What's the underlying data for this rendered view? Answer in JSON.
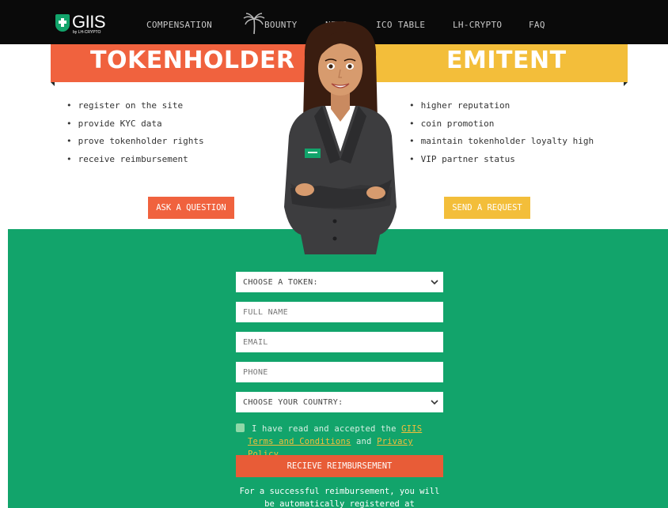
{
  "nav": {
    "logo_main": "GIIS",
    "logo_sub": "by LH-CRYPTO",
    "items": [
      "COMPENSATION",
      "BOUNTY",
      "NEWS",
      "ICO TABLE",
      "LH-CRYPTO",
      "FAQ"
    ]
  },
  "left": {
    "title": "TOKENHOLDER",
    "items": [
      "register on the site",
      "provide KYC data",
      "prove tokenholder rights",
      "receive reimbursement"
    ],
    "button": "ASK A QUESTION"
  },
  "right": {
    "title": "EMITENT",
    "items": [
      "higher reputation",
      "coin promotion",
      "maintain tokenholder loyalty high",
      "VIP partner status"
    ],
    "button": "SEND A REQUEST"
  },
  "form": {
    "token_select": "CHOOSE A TOKEN:",
    "full_name_placeholder": "FULL NAME",
    "email_placeholder": "EMAIL",
    "phone_placeholder": "PHONE",
    "country_select": "CHOOSE YOUR COUNTRY:",
    "agree_prefix": "I have read and accepted the",
    "agree_brand": "GIIS",
    "terms_link": "Terms and Conditions",
    "agree_and": "and",
    "privacy_link": "Privacy Policy",
    "submit": "RECIEVE REIMBURSEMENT",
    "note": "For a successful reimbursement, you will be automatically registered at"
  },
  "colors": {
    "nav_bg": "#0a0a0a",
    "orange": "#f0623e",
    "yellow": "#f3be3a",
    "green": "#12a46b"
  }
}
